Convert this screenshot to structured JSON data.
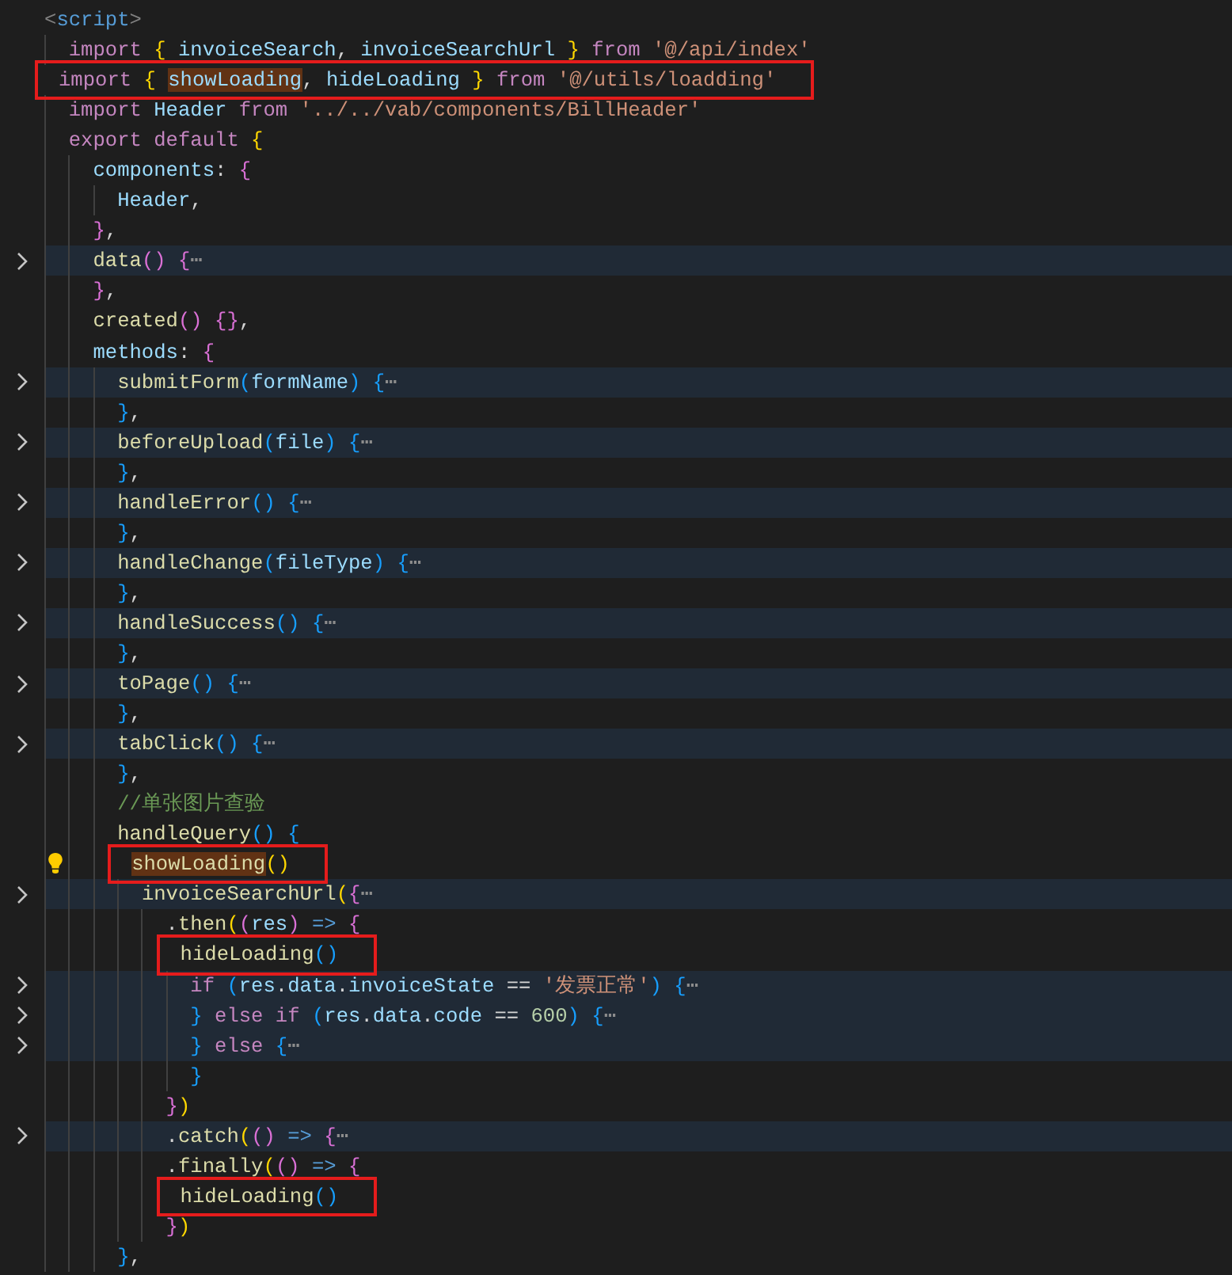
{
  "editor": {
    "lines": [
      {
        "folded": false,
        "boxed": false,
        "lightbulb": false,
        "tokens": [
          {
            "t": "<",
            "kind": "tag"
          },
          {
            "t": "script",
            "kind": "kw2"
          },
          {
            "t": ">",
            "kind": "tag"
          }
        ],
        "children": [
          {
            "folded": false,
            "boxed": false,
            "lightbulb": false,
            "tokens": [
              {
                "t": "import",
                "kind": "kw"
              },
              {
                "t": " {",
                "kind": "b1"
              },
              {
                "t": " invoiceSearch",
                "kind": "var"
              },
              {
                "t": ",",
                "kind": "op"
              },
              {
                "t": " invoiceSearchUrl",
                "kind": "var"
              },
              {
                "t": " }",
                "kind": "b1"
              },
              {
                "t": " from",
                "kind": "kw"
              },
              {
                "t": " '@/api/index'",
                "kind": "str"
              }
            ]
          },
          {
            "folded": false,
            "boxed": true,
            "lightbulb": false,
            "tokens": [
              {
                "t": "import",
                "kind": "kw"
              },
              {
                "t": " { ",
                "kind": "b1"
              },
              {
                "t": "showLoading",
                "kind": "var-hl"
              },
              {
                "t": ",",
                "kind": "op"
              },
              {
                "t": " hideLoading",
                "kind": "var"
              },
              {
                "t": " }",
                "kind": "b1"
              },
              {
                "t": " from",
                "kind": "kw"
              },
              {
                "t": " '@/utils/loadding'",
                "kind": "str"
              }
            ]
          },
          {
            "folded": false,
            "boxed": false,
            "lightbulb": false,
            "tokens": [
              {
                "t": "import",
                "kind": "kw"
              },
              {
                "t": " Header",
                "kind": "var"
              },
              {
                "t": " from",
                "kind": "kw"
              },
              {
                "t": " '../../vab/components/BillHeader'",
                "kind": "str"
              }
            ]
          },
          {
            "folded": false,
            "boxed": false,
            "lightbulb": false,
            "tokens": [
              {
                "t": "export",
                "kind": "kw"
              },
              {
                "t": " default",
                "kind": "kw"
              },
              {
                "t": " {",
                "kind": "b1"
              }
            ],
            "children": [
              {
                "folded": false,
                "boxed": false,
                "lightbulb": false,
                "tokens": [
                  {
                    "t": "components",
                    "kind": "var"
                  },
                  {
                    "t": ":",
                    "kind": "op"
                  },
                  {
                    "t": " {",
                    "kind": "b2"
                  }
                ],
                "children": [
                  {
                    "folded": false,
                    "boxed": false,
                    "lightbulb": false,
                    "tokens": [
                      {
                        "t": "Header",
                        "kind": "var"
                      },
                      {
                        "t": ",",
                        "kind": "op"
                      }
                    ]
                  }
                ]
              },
              {
                "folded": false,
                "boxed": false,
                "lightbulb": false,
                "tokens": [
                  {
                    "t": "}",
                    "kind": "b2"
                  },
                  {
                    "t": ",",
                    "kind": "op"
                  }
                ]
              },
              {
                "folded": true,
                "boxed": false,
                "lightbulb": false,
                "tokens": [
                  {
                    "t": "data",
                    "kind": "fn"
                  },
                  {
                    "t": "()",
                    "kind": "b2"
                  },
                  {
                    "t": " {",
                    "kind": "b2"
                  },
                  {
                    "t": "⋯",
                    "kind": "fold"
                  }
                ]
              },
              {
                "folded": false,
                "boxed": false,
                "lightbulb": false,
                "tokens": [
                  {
                    "t": "}",
                    "kind": "b2"
                  },
                  {
                    "t": ",",
                    "kind": "op"
                  }
                ]
              },
              {
                "folded": false,
                "boxed": false,
                "lightbulb": false,
                "tokens": [
                  {
                    "t": "created",
                    "kind": "fn"
                  },
                  {
                    "t": "()",
                    "kind": "b2"
                  },
                  {
                    "t": " {}",
                    "kind": "b2"
                  },
                  {
                    "t": ",",
                    "kind": "op"
                  }
                ]
              },
              {
                "folded": false,
                "boxed": false,
                "lightbulb": false,
                "tokens": [
                  {
                    "t": "methods",
                    "kind": "var"
                  },
                  {
                    "t": ":",
                    "kind": "op"
                  },
                  {
                    "t": " {",
                    "kind": "b2"
                  }
                ],
                "children": [
                  {
                    "folded": true,
                    "boxed": false,
                    "lightbulb": false,
                    "tokens": [
                      {
                        "t": "submitForm",
                        "kind": "fn"
                      },
                      {
                        "t": "(",
                        "kind": "b3"
                      },
                      {
                        "t": "formName",
                        "kind": "var"
                      },
                      {
                        "t": ")",
                        "kind": "b3"
                      },
                      {
                        "t": " {",
                        "kind": "b3"
                      },
                      {
                        "t": "⋯",
                        "kind": "fold"
                      }
                    ]
                  },
                  {
                    "folded": false,
                    "boxed": false,
                    "lightbulb": false,
                    "tokens": [
                      {
                        "t": "}",
                        "kind": "b3"
                      },
                      {
                        "t": ",",
                        "kind": "op"
                      }
                    ]
                  },
                  {
                    "folded": true,
                    "boxed": false,
                    "lightbulb": false,
                    "tokens": [
                      {
                        "t": "beforeUpload",
                        "kind": "fn"
                      },
                      {
                        "t": "(",
                        "kind": "b3"
                      },
                      {
                        "t": "file",
                        "kind": "var"
                      },
                      {
                        "t": ")",
                        "kind": "b3"
                      },
                      {
                        "t": " {",
                        "kind": "b3"
                      },
                      {
                        "t": "⋯",
                        "kind": "fold"
                      }
                    ]
                  },
                  {
                    "folded": false,
                    "boxed": false,
                    "lightbulb": false,
                    "tokens": [
                      {
                        "t": "}",
                        "kind": "b3"
                      },
                      {
                        "t": ",",
                        "kind": "op"
                      }
                    ]
                  },
                  {
                    "folded": true,
                    "boxed": false,
                    "lightbulb": false,
                    "tokens": [
                      {
                        "t": "handleError",
                        "kind": "fn"
                      },
                      {
                        "t": "()",
                        "kind": "b3"
                      },
                      {
                        "t": " {",
                        "kind": "b3"
                      },
                      {
                        "t": "⋯",
                        "kind": "fold"
                      }
                    ]
                  },
                  {
                    "folded": false,
                    "boxed": false,
                    "lightbulb": false,
                    "tokens": [
                      {
                        "t": "}",
                        "kind": "b3"
                      },
                      {
                        "t": ",",
                        "kind": "op"
                      }
                    ]
                  },
                  {
                    "folded": true,
                    "boxed": false,
                    "lightbulb": false,
                    "tokens": [
                      {
                        "t": "handleChange",
                        "kind": "fn"
                      },
                      {
                        "t": "(",
                        "kind": "b3"
                      },
                      {
                        "t": "fileType",
                        "kind": "var"
                      },
                      {
                        "t": ")",
                        "kind": "b3"
                      },
                      {
                        "t": " {",
                        "kind": "b3"
                      },
                      {
                        "t": "⋯",
                        "kind": "fold"
                      }
                    ]
                  },
                  {
                    "folded": false,
                    "boxed": false,
                    "lightbulb": false,
                    "tokens": [
                      {
                        "t": "}",
                        "kind": "b3"
                      },
                      {
                        "t": ",",
                        "kind": "op"
                      }
                    ]
                  },
                  {
                    "folded": true,
                    "boxed": false,
                    "lightbulb": false,
                    "tokens": [
                      {
                        "t": "handleSuccess",
                        "kind": "fn"
                      },
                      {
                        "t": "()",
                        "kind": "b3"
                      },
                      {
                        "t": " {",
                        "kind": "b3"
                      },
                      {
                        "t": "⋯",
                        "kind": "fold"
                      }
                    ]
                  },
                  {
                    "folded": false,
                    "boxed": false,
                    "lightbulb": false,
                    "tokens": [
                      {
                        "t": "}",
                        "kind": "b3"
                      },
                      {
                        "t": ",",
                        "kind": "op"
                      }
                    ]
                  },
                  {
                    "folded": true,
                    "boxed": false,
                    "lightbulb": false,
                    "tokens": [
                      {
                        "t": "toPage",
                        "kind": "fn"
                      },
                      {
                        "t": "()",
                        "kind": "b3"
                      },
                      {
                        "t": " {",
                        "kind": "b3"
                      },
                      {
                        "t": "⋯",
                        "kind": "fold"
                      }
                    ]
                  },
                  {
                    "folded": false,
                    "boxed": false,
                    "lightbulb": false,
                    "tokens": [
                      {
                        "t": "}",
                        "kind": "b3"
                      },
                      {
                        "t": ",",
                        "kind": "op"
                      }
                    ]
                  },
                  {
                    "folded": true,
                    "boxed": false,
                    "lightbulb": false,
                    "tokens": [
                      {
                        "t": "tabClick",
                        "kind": "fn"
                      },
                      {
                        "t": "()",
                        "kind": "b3"
                      },
                      {
                        "t": " {",
                        "kind": "b3"
                      },
                      {
                        "t": "⋯",
                        "kind": "fold"
                      }
                    ]
                  },
                  {
                    "folded": false,
                    "boxed": false,
                    "lightbulb": false,
                    "tokens": [
                      {
                        "t": "}",
                        "kind": "b3"
                      },
                      {
                        "t": ",",
                        "kind": "op"
                      }
                    ]
                  },
                  {
                    "folded": false,
                    "boxed": false,
                    "lightbulb": false,
                    "tokens": [
                      {
                        "t": "//单张图片查验",
                        "kind": "cm"
                      }
                    ]
                  },
                  {
                    "folded": false,
                    "boxed": false,
                    "lightbulb": false,
                    "tokens": [
                      {
                        "t": "handleQuery",
                        "kind": "fn"
                      },
                      {
                        "t": "()",
                        "kind": "b3"
                      },
                      {
                        "t": " {",
                        "kind": "b3"
                      }
                    ],
                    "children": [
                      {
                        "folded": false,
                        "boxed": true,
                        "lightbulb": true,
                        "tokens": [
                          {
                            "t": "showLoading",
                            "kind": "fn-hl"
                          },
                          {
                            "t": "()",
                            "kind": "b1"
                          }
                        ]
                      },
                      {
                        "folded": true,
                        "boxed": false,
                        "lightbulb": false,
                        "tokens": [
                          {
                            "t": "invoiceSearchUrl",
                            "kind": "fn"
                          },
                          {
                            "t": "(",
                            "kind": "b1"
                          },
                          {
                            "t": "{",
                            "kind": "b2"
                          },
                          {
                            "t": "⋯",
                            "kind": "fold"
                          }
                        ],
                        "children": [
                          {
                            "folded": false,
                            "boxed": false,
                            "lightbulb": false,
                            "tokens": [
                              {
                                "t": ".",
                                "kind": "op"
                              },
                              {
                                "t": "then",
                                "kind": "fn"
                              },
                              {
                                "t": "(",
                                "kind": "b1"
                              },
                              {
                                "t": "(",
                                "kind": "b2"
                              },
                              {
                                "t": "res",
                                "kind": "var"
                              },
                              {
                                "t": ")",
                                "kind": "b2"
                              },
                              {
                                "t": " =>",
                                "kind": "kw2"
                              },
                              {
                                "t": " {",
                                "kind": "b2"
                              }
                            ],
                            "children": [
                              {
                                "folded": false,
                                "boxed": true,
                                "lightbulb": false,
                                "tokens": [
                                  {
                                    "t": "hideLoading",
                                    "kind": "fn"
                                  },
                                  {
                                    "t": "()",
                                    "kind": "b3"
                                  }
                                ]
                              },
                              {
                                "folded": true,
                                "boxed": false,
                                "lightbulb": false,
                                "tokens": [
                                  {
                                    "t": "if",
                                    "kind": "kw"
                                  },
                                  {
                                    "t": " (",
                                    "kind": "b3"
                                  },
                                  {
                                    "t": "res",
                                    "kind": "var"
                                  },
                                  {
                                    "t": ".",
                                    "kind": "op"
                                  },
                                  {
                                    "t": "data",
                                    "kind": "var"
                                  },
                                  {
                                    "t": ".",
                                    "kind": "op"
                                  },
                                  {
                                    "t": "invoiceState",
                                    "kind": "var"
                                  },
                                  {
                                    "t": " ==",
                                    "kind": "op"
                                  },
                                  {
                                    "t": " '发票正常'",
                                    "kind": "str"
                                  },
                                  {
                                    "t": ")",
                                    "kind": "b3"
                                  },
                                  {
                                    "t": " {",
                                    "kind": "b3"
                                  },
                                  {
                                    "t": "⋯",
                                    "kind": "fold"
                                  }
                                ]
                              },
                              {
                                "folded": true,
                                "boxed": false,
                                "lightbulb": false,
                                "tokens": [
                                  {
                                    "t": "}",
                                    "kind": "b3"
                                  },
                                  {
                                    "t": " else",
                                    "kind": "kw"
                                  },
                                  {
                                    "t": " if",
                                    "kind": "kw"
                                  },
                                  {
                                    "t": " (",
                                    "kind": "b3"
                                  },
                                  {
                                    "t": "res",
                                    "kind": "var"
                                  },
                                  {
                                    "t": ".",
                                    "kind": "op"
                                  },
                                  {
                                    "t": "data",
                                    "kind": "var"
                                  },
                                  {
                                    "t": ".",
                                    "kind": "op"
                                  },
                                  {
                                    "t": "code",
                                    "kind": "var"
                                  },
                                  {
                                    "t": " ==",
                                    "kind": "op"
                                  },
                                  {
                                    "t": " 600",
                                    "kind": "num"
                                  },
                                  {
                                    "t": ")",
                                    "kind": "b3"
                                  },
                                  {
                                    "t": " {",
                                    "kind": "b3"
                                  },
                                  {
                                    "t": "⋯",
                                    "kind": "fold"
                                  }
                                ]
                              },
                              {
                                "folded": true,
                                "boxed": false,
                                "lightbulb": false,
                                "tokens": [
                                  {
                                    "t": "}",
                                    "kind": "b3"
                                  },
                                  {
                                    "t": " else",
                                    "kind": "kw"
                                  },
                                  {
                                    "t": " {",
                                    "kind": "b3"
                                  },
                                  {
                                    "t": "⋯",
                                    "kind": "fold"
                                  }
                                ]
                              },
                              {
                                "folded": false,
                                "boxed": false,
                                "lightbulb": false,
                                "tokens": [
                                  {
                                    "t": "}",
                                    "kind": "b3"
                                  }
                                ]
                              }
                            ]
                          },
                          {
                            "folded": false,
                            "boxed": false,
                            "lightbulb": false,
                            "tokens": [
                              {
                                "t": "}",
                                "kind": "b2"
                              },
                              {
                                "t": ")",
                                "kind": "b1"
                              }
                            ]
                          },
                          {
                            "folded": true,
                            "boxed": false,
                            "lightbulb": false,
                            "tokens": [
                              {
                                "t": ".",
                                "kind": "op"
                              },
                              {
                                "t": "catch",
                                "kind": "fn"
                              },
                              {
                                "t": "(",
                                "kind": "b1"
                              },
                              {
                                "t": "()",
                                "kind": "b2"
                              },
                              {
                                "t": " =>",
                                "kind": "kw2"
                              },
                              {
                                "t": " {",
                                "kind": "b2"
                              },
                              {
                                "t": "⋯",
                                "kind": "fold"
                              }
                            ]
                          },
                          {
                            "folded": false,
                            "boxed": false,
                            "lightbulb": false,
                            "tokens": [
                              {
                                "t": ".",
                                "kind": "op"
                              },
                              {
                                "t": "finally",
                                "kind": "fn"
                              },
                              {
                                "t": "(",
                                "kind": "b1"
                              },
                              {
                                "t": "()",
                                "kind": "b2"
                              },
                              {
                                "t": " =>",
                                "kind": "kw2"
                              },
                              {
                                "t": " {",
                                "kind": "b2"
                              }
                            ],
                            "children": [
                              {
                                "folded": false,
                                "boxed": true,
                                "lightbulb": false,
                                "tokens": [
                                  {
                                    "t": "hideLoading",
                                    "kind": "fn"
                                  },
                                  {
                                    "t": "()",
                                    "kind": "b3"
                                  }
                                ]
                              }
                            ]
                          },
                          {
                            "folded": false,
                            "boxed": false,
                            "lightbulb": false,
                            "tokens": [
                              {
                                "t": "}",
                                "kind": "b2"
                              },
                              {
                                "t": ")",
                                "kind": "b1"
                              }
                            ]
                          }
                        ]
                      }
                    ]
                  },
                  {
                    "folded": false,
                    "boxed": false,
                    "lightbulb": false,
                    "tokens": [
                      {
                        "t": "}",
                        "kind": "b3"
                      },
                      {
                        "t": ",",
                        "kind": "op"
                      }
                    ]
                  }
                ]
              }
            ]
          }
        ]
      }
    ]
  }
}
